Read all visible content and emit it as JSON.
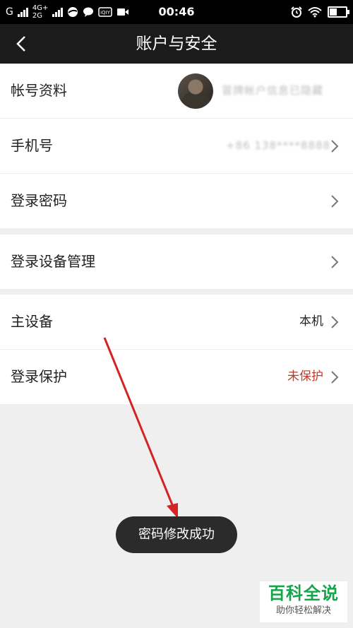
{
  "status_bar": {
    "carrier": "G",
    "net_top": "4G+",
    "net_bottom": "2G",
    "time": "00:46"
  },
  "header": {
    "title": "账户与安全"
  },
  "groups": [
    {
      "items": [
        {
          "label": "帐号资料",
          "value_blurred": "冒牌帐户信息已隐藏"
        },
        {
          "label": "手机号",
          "value_blurred": "+86 138****8888"
        },
        {
          "label": "登录密码"
        }
      ]
    },
    {
      "items": [
        {
          "label": "登录设备管理"
        }
      ]
    },
    {
      "items": [
        {
          "label": "主设备",
          "value": "本机"
        },
        {
          "label": "登录保护",
          "value": "未保护"
        }
      ]
    }
  ],
  "toast": {
    "text": "密码修改成功"
  },
  "watermark": {
    "title": "百科全说",
    "subtitle": "助你轻松解决"
  },
  "colors": {
    "status_bar_bg": "#000000",
    "title_bar_bg": "#1b1b1b",
    "page_bg": "#efefef",
    "warning": "#c0392b",
    "arrow": "#d42323",
    "watermark_green": "#16a34a"
  }
}
